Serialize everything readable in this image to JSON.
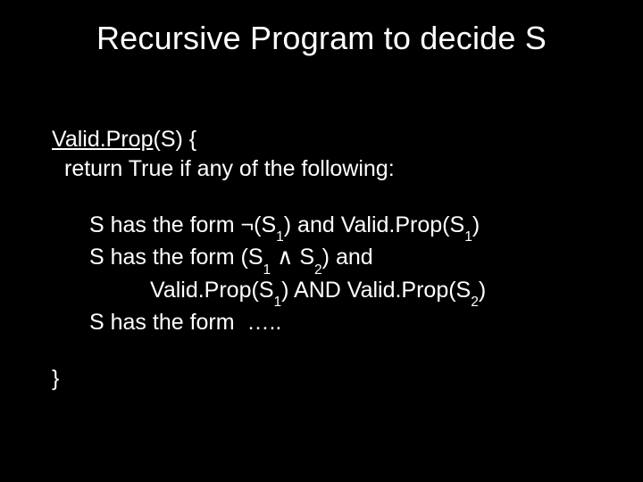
{
  "title": "Recursive Program to decide S",
  "fn_name": "Valid.Prop",
  "fn_arg": "(S) {",
  "ret_line": "return True if any of the following:",
  "case1_a": "S has the form ",
  "neg": "¬",
  "case1_b": "(S",
  "sub1": "1",
  "case1_c": ") and Valid.Prop(S",
  "case1_d": ")",
  "case2_a": "S has the form (S",
  "and_sym": " ∧ ",
  "case2_b": "S",
  "sub2": "2",
  "case2_c": ") and",
  "case2_line2_a": "Valid.Prop(S",
  "case2_line2_b": ") AND Valid.Prop(S",
  "case2_line2_c": ")",
  "case3": "S has the form  …..",
  "close": "}"
}
